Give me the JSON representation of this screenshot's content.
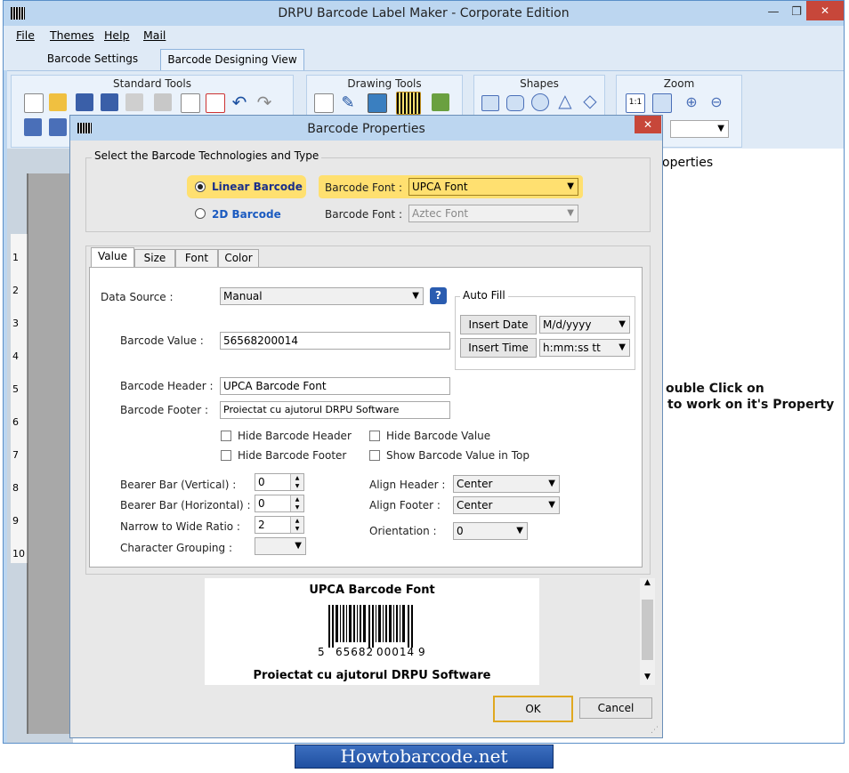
{
  "app": {
    "title": "DRPU Barcode Label Maker - Corporate Edition",
    "controls": {
      "minimize": "—",
      "restore": "❐",
      "close": "✕"
    }
  },
  "menu": [
    "File",
    "Themes",
    "Help",
    "Mail"
  ],
  "ribbon_tabs": [
    "Barcode Settings",
    "Barcode Designing View"
  ],
  "ribbon_groups": [
    "Standard Tools",
    "Drawing Tools",
    "Shapes",
    "Zoom"
  ],
  "zoom_button": "1:1",
  "ruler": [
    "1",
    "2",
    "3",
    "4",
    "5",
    "6",
    "7",
    "8",
    "9",
    "10"
  ],
  "background_text": {
    "properties": "operties",
    "hint_line1": "ouble Click on",
    "hint_line2": "to work on it's Property"
  },
  "dialog": {
    "title": "Barcode Properties",
    "close": "✕",
    "tech_section": "Select the Barcode Technologies and Type",
    "linear_label": "Linear Barcode",
    "twod_label": "2D Barcode",
    "font_label": "Barcode Font :",
    "linear_font": "UPCA Font",
    "twod_font": "Aztec Font",
    "tabs": [
      "Value",
      "Size",
      "Font",
      "Color"
    ],
    "data_source_label": "Data Source :",
    "data_source": "Manual",
    "help": "?",
    "auto_fill": "Auto Fill",
    "insert_date": "Insert Date",
    "date_format": "M/d/yyyy",
    "insert_time": "Insert Time",
    "time_format": "h:mm:ss tt",
    "barcode_value_label": "Barcode Value :",
    "barcode_value": "56568200014",
    "header_label": "Barcode Header :",
    "header_value": "UPCA Barcode Font",
    "footer_label": "Barcode Footer :",
    "footer_value": "Proiectat cu ajutorul DRPU Software",
    "hide_header": "Hide Barcode Header",
    "hide_footer": "Hide Barcode Footer",
    "hide_value": "Hide Barcode Value",
    "show_value_top": "Show Barcode Value in Top",
    "bearer_v_label": "Bearer Bar (Vertical) :",
    "bearer_v": "0",
    "bearer_h_label": "Bearer Bar (Horizontal) :",
    "bearer_h": "0",
    "narrow_label": "Narrow to Wide Ratio :",
    "narrow": "2",
    "char_group_label": "Character Grouping :",
    "align_header_label": "Align Header :",
    "align_header": "Center",
    "align_footer_label": "Align Footer :",
    "align_footer": "Center",
    "orientation_label": "Orientation :",
    "orientation": "0",
    "preview_header": "UPCA Barcode Font",
    "preview_digits": [
      "5",
      "65682",
      "00014",
      "9"
    ],
    "preview_footer": "Proiectat cu ajutorul DRPU Software",
    "ok": "OK",
    "cancel": "Cancel"
  },
  "footer_banner": "Howtobarcode.net",
  "colors": {
    "accent": "#bcd6f0",
    "highlight": "#ffe070",
    "close": "#c7473a",
    "banner": "#2a5cb0"
  }
}
